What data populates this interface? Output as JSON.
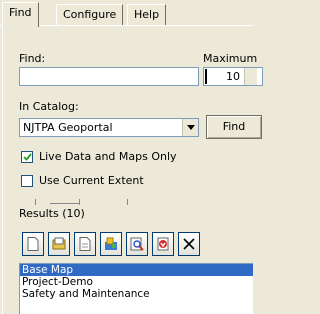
{
  "tabs": [
    {
      "label": "Find",
      "active": true
    },
    {
      "label": "Configure",
      "active": false
    },
    {
      "label": "Help",
      "active": false
    }
  ],
  "find": {
    "label": "Find:",
    "value": "",
    "maximum_label": "Maximum",
    "maximum_value": "10"
  },
  "catalog": {
    "label": "In Catalog:",
    "selected": "NJTPA Geoportal",
    "find_button": "Find"
  },
  "options": {
    "live_data": {
      "label": "Live Data and Maps Only",
      "checked": true
    },
    "current_extent": {
      "label": "Use Current Extent",
      "checked": false
    }
  },
  "results": {
    "label": "Results (10)",
    "items": [
      "Base Map",
      "Project-Demo",
      "Safety and Maintenance"
    ],
    "selected_index": 0
  },
  "toolbar": {
    "icons": [
      "document-icon",
      "open-icon",
      "details-icon",
      "add-to-map-icon",
      "zoom-to-icon",
      "download-icon",
      "clear-icon"
    ]
  },
  "colors": {
    "face": "#ece9d8",
    "selection": "#316ac5",
    "border": "#7f9db9"
  }
}
